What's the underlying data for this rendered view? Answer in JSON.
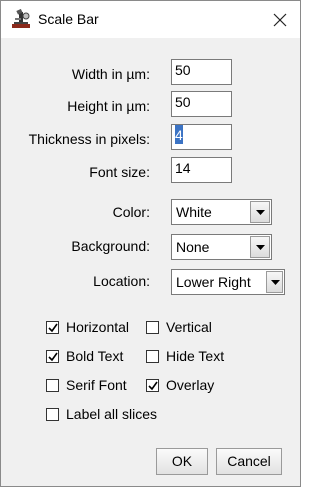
{
  "window": {
    "title": "Scale Bar"
  },
  "fields": [
    {
      "label": "Width in µm:",
      "value": "50"
    },
    {
      "label": "Height in µm:",
      "value": "50"
    },
    {
      "label": "Thickness in pixels:",
      "value": "4"
    },
    {
      "label": "Font size:",
      "value": "14"
    }
  ],
  "selects": [
    {
      "label": "Color:",
      "value": "White"
    },
    {
      "label": "Background:",
      "value": "None"
    },
    {
      "label": "Location:",
      "value": "Lower Right"
    }
  ],
  "checkboxes": [
    {
      "label": "Horizontal",
      "checked": true
    },
    {
      "label": "Vertical",
      "checked": false
    },
    {
      "label": "Bold Text",
      "checked": true
    },
    {
      "label": "Hide Text",
      "checked": false
    },
    {
      "label": "Serif Font",
      "checked": false
    },
    {
      "label": "Overlay",
      "checked": true
    },
    {
      "label": "Label all slices",
      "checked": false
    }
  ],
  "buttons": {
    "ok": "OK",
    "cancel": "Cancel"
  },
  "icons": {
    "app": "imagej-microscope-icon",
    "close": "close-icon",
    "dropdown": "chevron-down-icon",
    "check": "checkmark-icon"
  },
  "colors": {
    "dialog_background": "#f0f0f0",
    "selection": "#3b73c4"
  }
}
